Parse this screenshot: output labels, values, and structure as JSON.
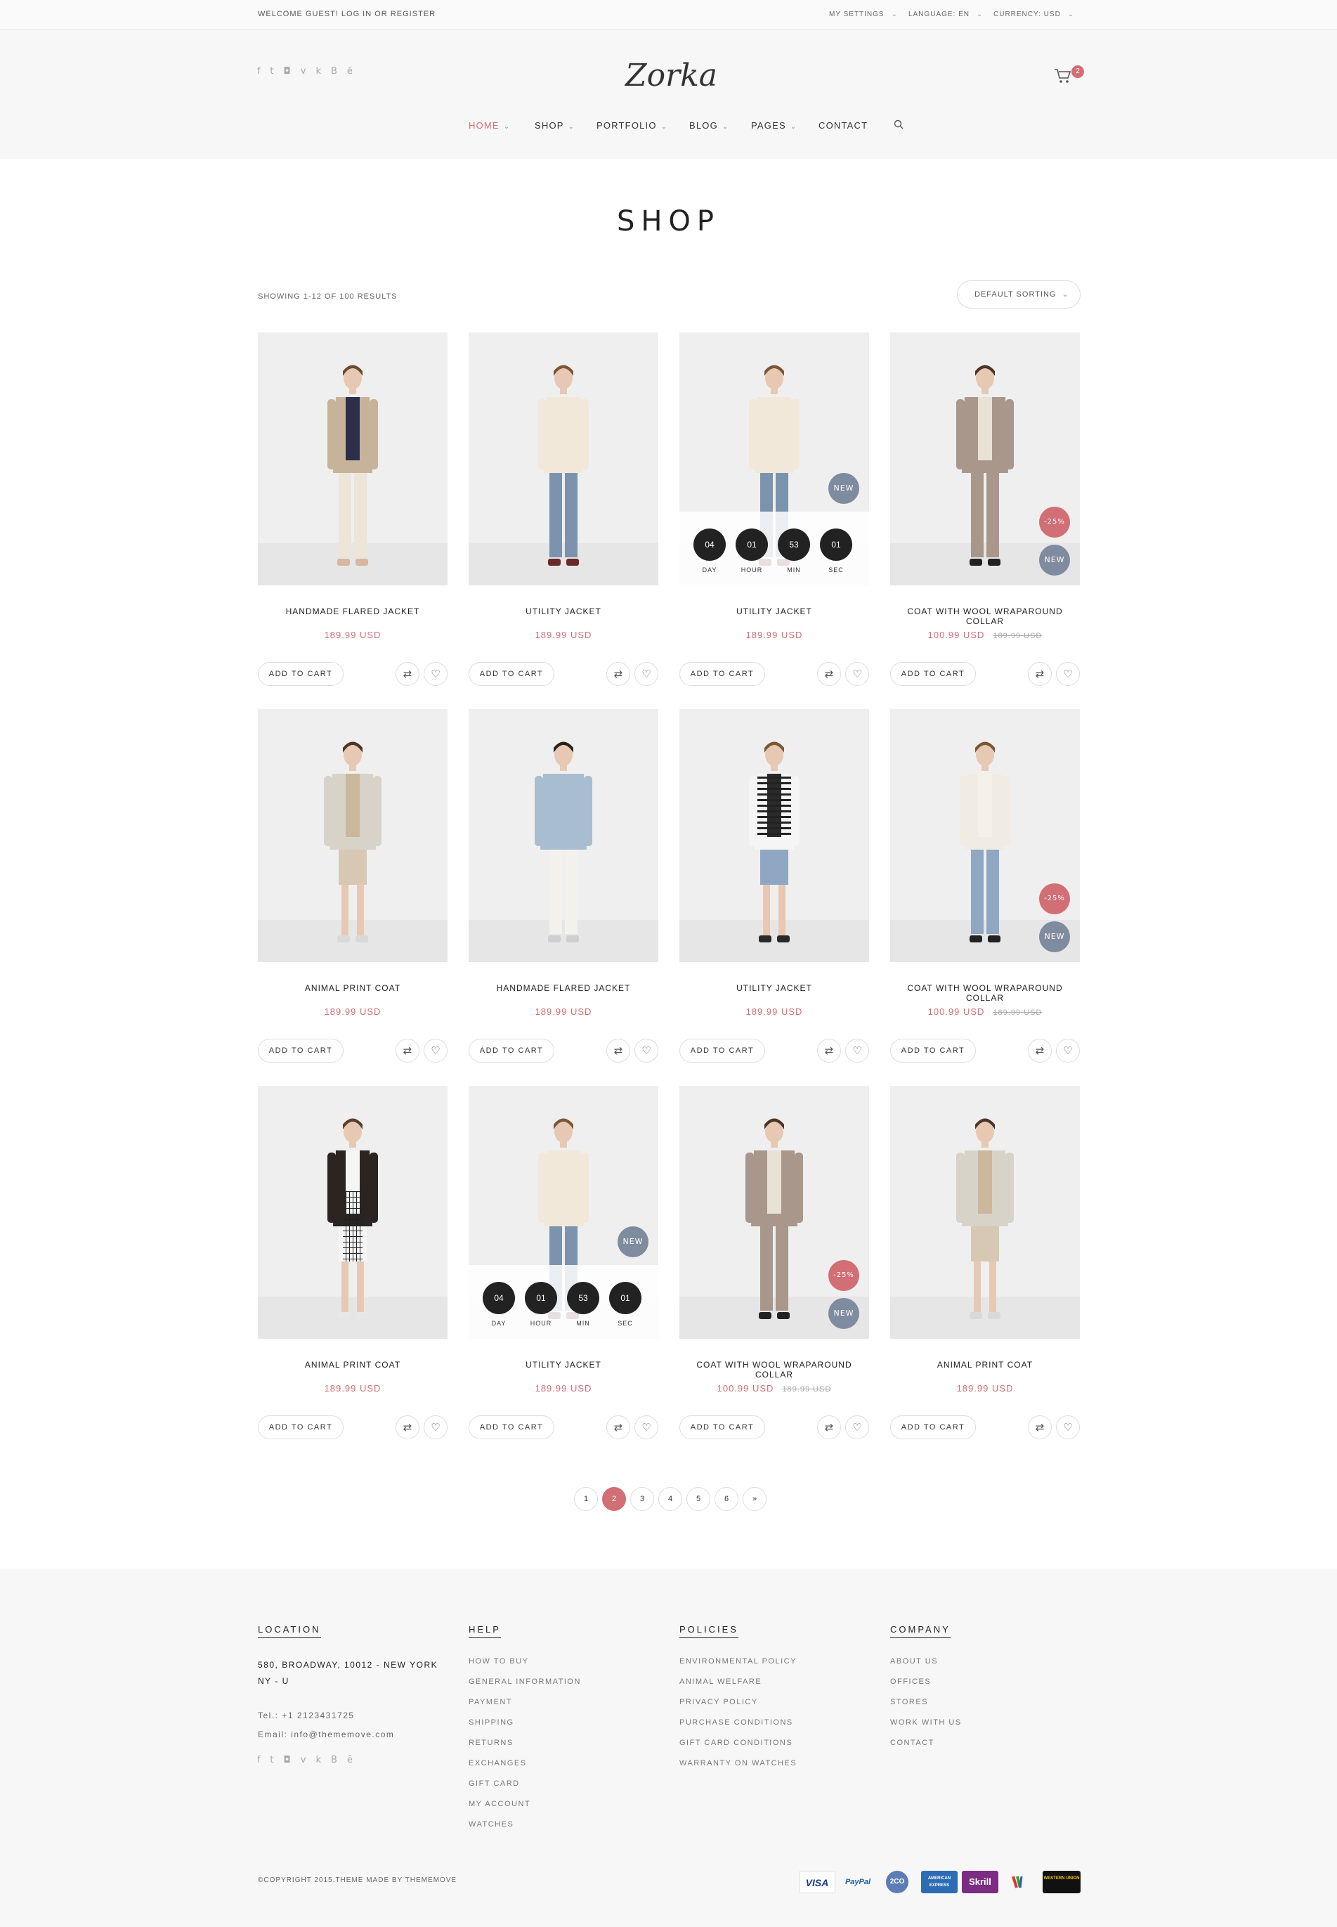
{
  "topbar": {
    "welcome": "WELCOME GUEST! LOG IN OR REGISTER",
    "my_settings": "MY SETTINGS",
    "language": "LANGUAGE: EN",
    "currency": "CURRENCY: USD"
  },
  "header": {
    "logo": "Zorka",
    "cart_count": "2",
    "social_icons": [
      "facebook-icon",
      "twitter-icon",
      "instagram-icon",
      "vk-icon",
      "behance-icon"
    ],
    "nav": [
      "HOME",
      "SHOP",
      "PORTFOLIO",
      "BLOG",
      "PAGES",
      "CONTACT"
    ]
  },
  "page": {
    "title": "SHOP",
    "result_count": "SHOWING 1-12 OF 100 RESULTS",
    "sort_label": "DEFAULT SORTING"
  },
  "labels": {
    "add_to_cart": "ADD TO CART",
    "new": "NEW",
    "sale": "-25%",
    "day": "DAY",
    "hour": "HOUR",
    "min": "MIN",
    "sec": "SEC"
  },
  "countdown": {
    "day": "04",
    "hour": "01",
    "min": "53",
    "sec": "01"
  },
  "products": [
    {
      "title": "HANDMADE FLARED JACKET",
      "price": "189.99 USD",
      "old_price": ""
    },
    {
      "title": "UTILITY JACKET",
      "price": "189.99 USD",
      "old_price": ""
    },
    {
      "title": "UTILITY JACKET",
      "price": "189.99 USD",
      "old_price": ""
    },
    {
      "title": "COAT WITH WOOL WRAPAROUND COLLAR",
      "price": "100.99 USD",
      "old_price": "189.99 USD"
    },
    {
      "title": "ANIMAL PRINT COAT",
      "price": "189.99 USD",
      "old_price": ""
    },
    {
      "title": "HANDMADE FLARED JACKET",
      "price": "189.99 USD",
      "old_price": ""
    },
    {
      "title": "UTILITY JACKET",
      "price": "189.99 USD",
      "old_price": ""
    },
    {
      "title": "COAT WITH WOOL WRAPAROUND COLLAR",
      "price": "100.99 USD",
      "old_price": "189.99 USD"
    },
    {
      "title": "ANIMAL PRINT COAT",
      "price": "189.99 USD",
      "old_price": ""
    },
    {
      "title": "UTILITY JACKET",
      "price": "189.99 USD",
      "old_price": ""
    },
    {
      "title": "COAT WITH WOOL WRAPAROUND COLLAR",
      "price": "100.99 USD",
      "old_price": "189.99 USD"
    },
    {
      "title": "ANIMAL PRINT COAT",
      "price": "189.99 USD",
      "old_price": ""
    }
  ],
  "pagination": [
    "1",
    "2",
    "3",
    "4",
    "5",
    "6",
    "»"
  ],
  "footer": {
    "location": {
      "title": "LOCATION",
      "address1": "580, BROADWAY, 10012 - NEW YORK",
      "address2": "NY - U",
      "tel": "Tel.: +1 2123431725",
      "email": "Email: info@thememove.com"
    },
    "help": {
      "title": "HELP",
      "links": [
        "HOW TO BUY",
        "GENERAL INFORMATION",
        "PAYMENT",
        "SHIPPING",
        "RETURNS",
        "EXCHANGES",
        "GIFT CARD",
        "MY ACCOUNT",
        "WATCHES"
      ]
    },
    "policies": {
      "title": "POLICIES",
      "links": [
        "ENVIRONMENTAL POLICY",
        "ANIMAL WELFARE",
        "PRIVACY POLICY",
        "PURCHASE CONDITIONS",
        "GIFT CARD CONDITIONS",
        "WARRANTY ON WATCHES"
      ]
    },
    "company": {
      "title": "COMPANY",
      "links": [
        "ABOUT US",
        "OFFICES",
        "STORES",
        "WORK WITH US",
        "CONTACT"
      ]
    },
    "copyright": "©COPYRIGHT 2015.THEME MADE BY THEMEMOVE",
    "payments": [
      "VISA",
      "PayPal",
      "2CO",
      "AMERICAN EXPRESS",
      "Skrill",
      "WESTERN UNION"
    ]
  },
  "colors": {
    "accent": "#d26e75",
    "new_badge": "#7f8b9f",
    "dark": "#222222"
  }
}
